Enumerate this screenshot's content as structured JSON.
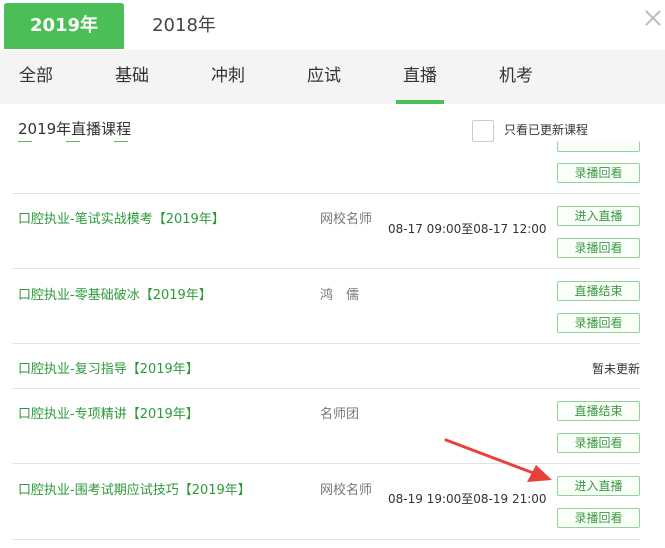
{
  "year_tabs": [
    {
      "label": "2019年",
      "active": true
    },
    {
      "label": "2018年",
      "active": false
    }
  ],
  "category_tabs": [
    {
      "label": "全部"
    },
    {
      "label": "基础"
    },
    {
      "label": "冲刺"
    },
    {
      "label": "应试"
    },
    {
      "label": "直播",
      "active": true
    },
    {
      "label": "机考"
    }
  ],
  "list": {
    "title": "2019年直播课程",
    "filter_label": "只看已更新课程"
  },
  "partial_row": {
    "replay_label": "录播回看"
  },
  "courses": [
    {
      "name": "口腔执业-笔试实战模考【2019年】",
      "teacher": "网校名师",
      "time": "08-17 09:00至08-17 12:00",
      "primary_button": "进入直播",
      "replay_button": "录播回看"
    },
    {
      "name": "口腔执业-零基础破冰【2019年】",
      "teacher": "鸿　儒",
      "primary_button": "直播结束",
      "replay_button": "录播回看"
    },
    {
      "name": "口腔执业-复习指导【2019年】",
      "status": "暂未更新"
    },
    {
      "name": "口腔执业-专项精讲【2019年】",
      "teacher": "名师团",
      "primary_button": "直播结束",
      "replay_button": "录播回看"
    },
    {
      "name": "口腔执业-围考试期应试技巧【2019年】",
      "teacher": "网校名师",
      "time": "08-19 19:00至08-19 21:00",
      "primary_button": "进入直播",
      "replay_button": "录播回看"
    }
  ],
  "colors": {
    "accent": "#4cbe57",
    "link": "#2c9a3b",
    "arrow": "#e8413c"
  }
}
